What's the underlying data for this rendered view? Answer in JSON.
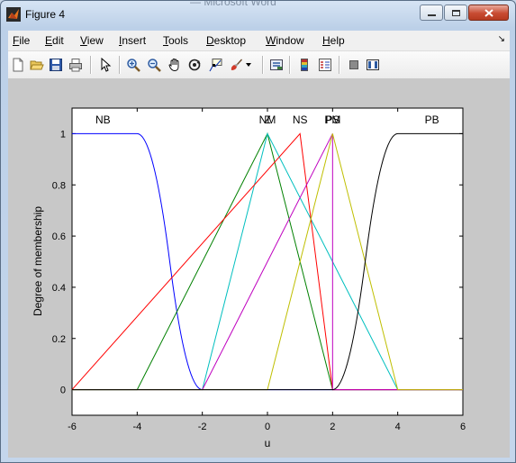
{
  "window": {
    "title": "Figure 4",
    "background_title": "— Microsoft Word",
    "controls": [
      "minimize",
      "maximize",
      "close"
    ]
  },
  "menu": [
    {
      "label": "File",
      "mnemonic": "F",
      "rest": "ile"
    },
    {
      "label": "Edit",
      "mnemonic": "E",
      "rest": "dit"
    },
    {
      "label": "View",
      "mnemonic": "V",
      "rest": "iew"
    },
    {
      "label": "Insert",
      "mnemonic": "I",
      "rest": "nsert"
    },
    {
      "label": "Tools",
      "mnemonic": "T",
      "rest": "ools"
    },
    {
      "label": "Desktop",
      "mnemonic": "D",
      "rest": "esktop"
    },
    {
      "label": "Window",
      "mnemonic": "W",
      "rest": "indow"
    },
    {
      "label": "Help",
      "mnemonic": "H",
      "rest": "elp"
    }
  ],
  "toolbar": [
    "new-figure-icon",
    "open-file-icon",
    "save-icon",
    "print-icon",
    "edit-plot-arrow-icon",
    "zoom-in-icon",
    "zoom-out-icon",
    "pan-hand-icon",
    "rotate-3d-icon",
    "data-cursor-icon",
    "brush-icon",
    "brush-dropdown-icon",
    "link-plot-icon",
    "insert-colorbar-icon",
    "insert-legend-icon",
    "hide-plot-tools-icon",
    "show-plot-tools-icon"
  ],
  "chart_data": {
    "type": "line",
    "title": "",
    "xlabel": "u",
    "ylabel": "Degree of membership",
    "xlim": [
      -6,
      6
    ],
    "ylim": [
      -0.1,
      1.1
    ],
    "xticks": [
      -6,
      -4,
      -2,
      0,
      2,
      4,
      6
    ],
    "yticks": [
      0,
      0.2,
      0.4,
      0.6,
      0.8,
      1
    ],
    "grid": false,
    "legend": "none",
    "series": [
      {
        "name": "NB",
        "color": "#0000ff",
        "shape": "zmf",
        "params": [
          -4,
          -2
        ],
        "x": [
          -6,
          -4,
          -3,
          -2,
          6
        ],
        "y": [
          1,
          1,
          0.5,
          0,
          0
        ]
      },
      {
        "name": "NM",
        "color": "#008000",
        "shape": "trimf",
        "params": [
          -4,
          0,
          2
        ],
        "x": [
          -6,
          -4,
          0,
          2,
          6
        ],
        "y": [
          0,
          0,
          1,
          0,
          0
        ]
      },
      {
        "name": "Z",
        "color": "#00bfbf",
        "shape": "trimf",
        "params": [
          -2,
          0,
          4
        ],
        "x": [
          -6,
          -2,
          0,
          4,
          6
        ],
        "y": [
          0,
          0,
          1,
          0,
          0
        ]
      },
      {
        "name": "NS",
        "color": "#ff0000",
        "shape": "trimf",
        "params": [
          -6,
          1,
          2
        ],
        "x": [
          -6,
          1,
          2,
          6
        ],
        "y": [
          0,
          1,
          0,
          0
        ]
      },
      {
        "name": "PS",
        "color": "#bf00bf",
        "shape": "trimf",
        "params": [
          -2,
          2,
          2
        ],
        "x": [
          -6,
          -2,
          2,
          2,
          6
        ],
        "y": [
          0,
          0,
          1,
          0,
          0
        ]
      },
      {
        "name": "PM",
        "color": "#bfbf00",
        "shape": "trimf",
        "params": [
          0,
          2,
          4
        ],
        "x": [
          -6,
          0,
          2,
          4,
          6
        ],
        "y": [
          0,
          0,
          1,
          0,
          0
        ]
      },
      {
        "name": "PB",
        "color": "#000000",
        "shape": "gbell-like",
        "params": [
          2,
          4
        ],
        "x": [
          -6,
          2,
          3,
          4,
          6
        ],
        "y": [
          0,
          0,
          0.5,
          1,
          1
        ]
      }
    ],
    "annotations": [
      {
        "text": "NB",
        "x": -5.05
      },
      {
        "text": "NM",
        "x": 0
      },
      {
        "text": "Z",
        "x": 0
      },
      {
        "text": "NS",
        "x": 1
      },
      {
        "text": "PM",
        "x": 2
      },
      {
        "text": "PS",
        "x": 2
      },
      {
        "text": "PB",
        "x": 5.05
      }
    ]
  }
}
